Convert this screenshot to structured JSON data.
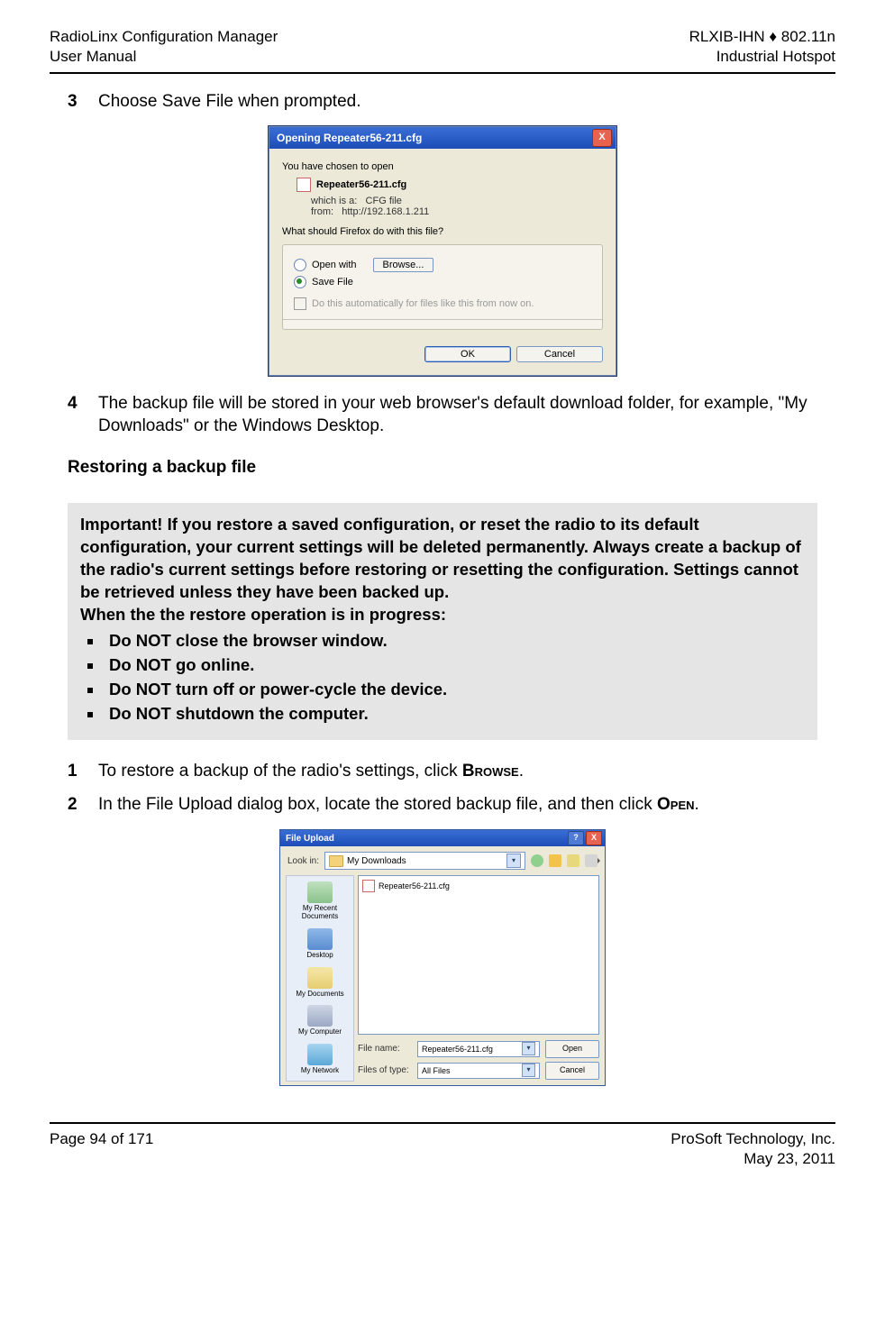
{
  "header": {
    "left1": "RadioLinx Configuration Manager",
    "left2": "User Manual",
    "right1": "RLXIB-IHN ♦ 802.11n",
    "right2": "Industrial Hotspot"
  },
  "step3": {
    "num": "3",
    "text": "Choose Save File when prompted."
  },
  "dialog1": {
    "title": "Opening Repeater56-211.cfg",
    "chosen": "You have chosen to open",
    "filename": "Repeater56-211.cfg",
    "which_is_label": "which is a:",
    "which_is_value": "CFG file",
    "from_label": "from:",
    "from_value": "http://192.168.1.211",
    "question": "What should Firefox do with this file?",
    "open_with": "Open with",
    "browse": "Browse...",
    "save_file": "Save File",
    "auto": "Do this automatically for files like this from now on.",
    "ok": "OK",
    "cancel": "Cancel"
  },
  "step4": {
    "num": "4",
    "text": "The backup file will be stored in your web browser's default download folder, for example, \"My Downloads\" or the Windows Desktop."
  },
  "restore_heading": "Restoring a backup file",
  "note": {
    "p1": "Important! If you restore a saved configuration, or reset the radio to its default configuration, your current settings will be deleted permanently. Always create a backup of the radio's current settings before restoring or resetting the configuration. Settings cannot be retrieved unless they have been backed up.",
    "p2": "When the the restore operation is in progress:",
    "b1": "Do NOT close the browser window.",
    "b2": "Do NOT go online.",
    "b3": "Do NOT turn off or power-cycle the device.",
    "b4": "Do NOT shutdown the computer."
  },
  "step_r1": {
    "num": "1",
    "pre": "To restore a backup of the radio's settings, click ",
    "btn": "Browse",
    "post": "."
  },
  "step_r2": {
    "num": "2",
    "pre": "In the File Upload dialog box, locate the stored backup file, and then click ",
    "btn": "Open",
    "post": "."
  },
  "dialog2": {
    "title": "File Upload",
    "lookin": "Look in:",
    "folder": "My Downloads",
    "file": "Repeater56-211.cfg",
    "side": {
      "recent": "My Recent Documents",
      "desktop": "Desktop",
      "docs": "My Documents",
      "comp": "My Computer",
      "net": "My Network"
    },
    "filename_label": "File name:",
    "filename_value": "Repeater56-211.cfg",
    "type_label": "Files of type:",
    "type_value": "All Files",
    "open": "Open",
    "cancel": "Cancel"
  },
  "footer": {
    "left": "Page 94 of 171",
    "right1": "ProSoft Technology, Inc.",
    "right2": "May 23, 2011"
  }
}
